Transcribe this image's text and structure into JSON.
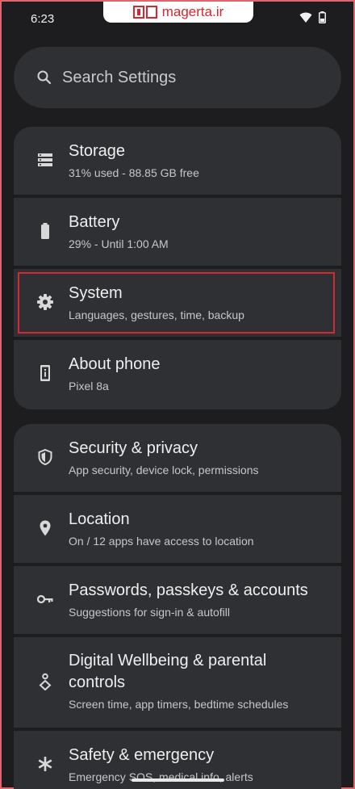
{
  "status_bar": {
    "time": "6:23"
  },
  "watermark": {
    "text": "magerta.ir"
  },
  "search": {
    "placeholder": "Search Settings"
  },
  "items": [
    {
      "title": "Storage",
      "subtitle": "31% used - 88.85 GB free",
      "icon": "storage-icon"
    },
    {
      "title": "Battery",
      "subtitle": "29% - Until 1:00 AM",
      "icon": "battery-icon"
    },
    {
      "title": "System",
      "subtitle": "Languages, gestures, time, backup",
      "icon": "gear-icon"
    },
    {
      "title": "About phone",
      "subtitle": "Pixel 8a",
      "icon": "phone-info-icon"
    },
    {
      "title": "Security & privacy",
      "subtitle": "App security, device lock, permissions",
      "icon": "shield-icon"
    },
    {
      "title": "Location",
      "subtitle": "On / 12 apps have access to location",
      "icon": "location-pin-icon"
    },
    {
      "title": "Passwords, passkeys & accounts",
      "subtitle": "Suggestions for sign-in & autofill",
      "icon": "key-icon"
    },
    {
      "title_line1": "Digital Wellbeing & parental",
      "title_line2": "controls",
      "subtitle": "Screen time, app timers, bedtime schedules",
      "icon": "wellbeing-icon"
    },
    {
      "title": "Safety & emergency",
      "subtitle": "Emergency SOS, medical info, alerts",
      "icon": "asterisk-icon"
    }
  ],
  "highlight_color": "#d22a33"
}
